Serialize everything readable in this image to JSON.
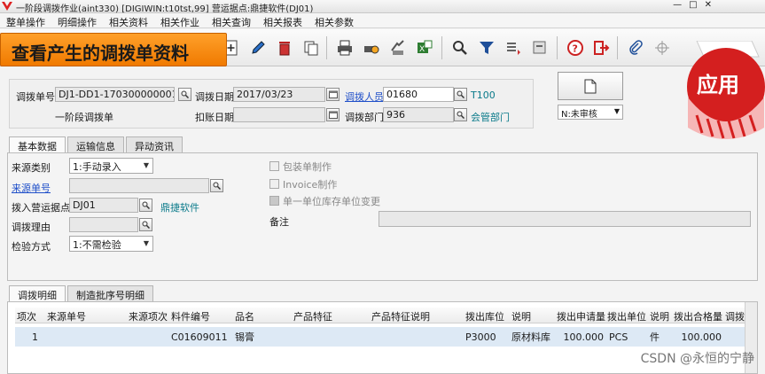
{
  "window": {
    "title": "一阶段调拨作业(aint330)  [DIGIWIN:t10tst,99]   营运据点:鼎捷软件(DJ01)"
  },
  "menu": [
    "整单操作",
    "明细操作",
    "相关资料",
    "相关作业",
    "相关查询",
    "相关报表",
    "相关参数"
  ],
  "banner": "查看产生的调拨单资料",
  "apply_badge": "应用",
  "header": {
    "doc_no_label": "调拨单号",
    "doc_no_value": "DJ1-DD1-170300000001",
    "doc_date_label": "调拨日期",
    "doc_date_value": "2017/03/23",
    "person_label": "调拨人员",
    "person_value": "01680",
    "person_name": "T100",
    "type_text": "一阶段调拨单",
    "post_date_label": "扣账日期",
    "post_date_value": "",
    "dept_label": "调拨部门",
    "dept_value": "936",
    "dept_name": "会管部门",
    "status_value": "N:未审核"
  },
  "tabs_upper": [
    "基本数据",
    "运输信息",
    "异动资讯"
  ],
  "basic": {
    "source_type_label": "来源类别",
    "source_type_value": "1:手动录入",
    "source_no_label": "来源单号",
    "source_no_value": "",
    "in_site_label": "拨入营运据点",
    "in_site_value": "DJ01",
    "in_site_name": "鼎捷软件",
    "reason_label": "调拨理由",
    "reason_value": "",
    "inspect_label": "检验方式",
    "inspect_value": "1:不需检验",
    "pack_label": "包装单制作",
    "invoice_label": "Invoice制作",
    "single_unit_label": "单一单位库存单位变更",
    "remark_label": "备注",
    "remark_value": ""
  },
  "tabs_lower": [
    "调拨明细",
    "制造批序号明细"
  ],
  "grid": {
    "headers": [
      "项次",
      "来源单号",
      "来源项次",
      "料件编号",
      "品名",
      "产品特征",
      "产品特征说明",
      "拨出库位",
      "说明",
      "拨出申请量",
      "拨出单位",
      "说明",
      "拨出合格量",
      "调拨"
    ],
    "rows": [
      [
        "1",
        "",
        "",
        "C01609011",
        "锡膏",
        "",
        "",
        "P3000",
        "原材料库",
        "100.000",
        "PCS",
        "件",
        "100.000",
        ""
      ]
    ]
  },
  "watermark": "CSDN @永恒的宁静",
  "colors": {
    "banner": "#f58a14",
    "badge_red": "#d41f1f",
    "link": "#1f4fc9",
    "selected_row": "#dde9f5"
  }
}
